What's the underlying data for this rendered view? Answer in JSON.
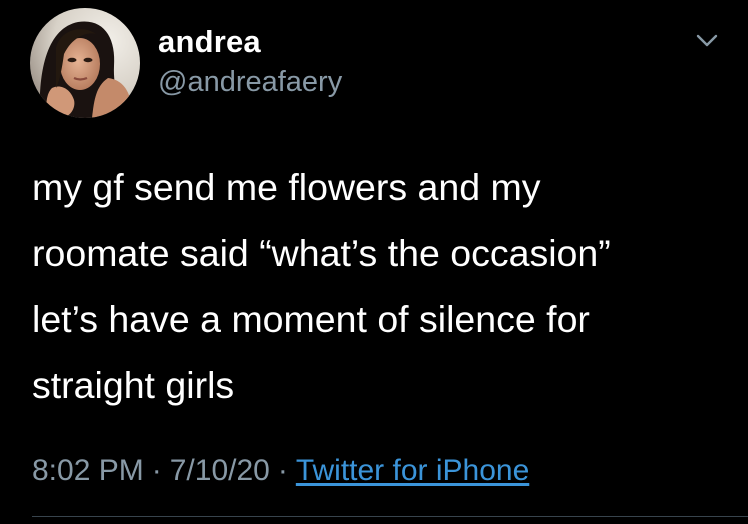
{
  "tweet": {
    "display_name": "andrea",
    "handle": "@andreafaery",
    "text_lines": [
      "my gf send me flowers and my",
      "roomate said “what’s the occasion”",
      "let’s have a moment of silence for",
      "straight girls"
    ],
    "time": "8:02 PM",
    "date": "7/10/20",
    "separator": "·",
    "source": "Twitter for iPhone"
  },
  "icons": {
    "menu": "chevron-down-icon",
    "avatar": "profile-photo"
  },
  "colors": {
    "background": "#000000",
    "primary_text": "#ffffff",
    "secondary_text": "#8899a6",
    "link": "#3b94d9"
  }
}
